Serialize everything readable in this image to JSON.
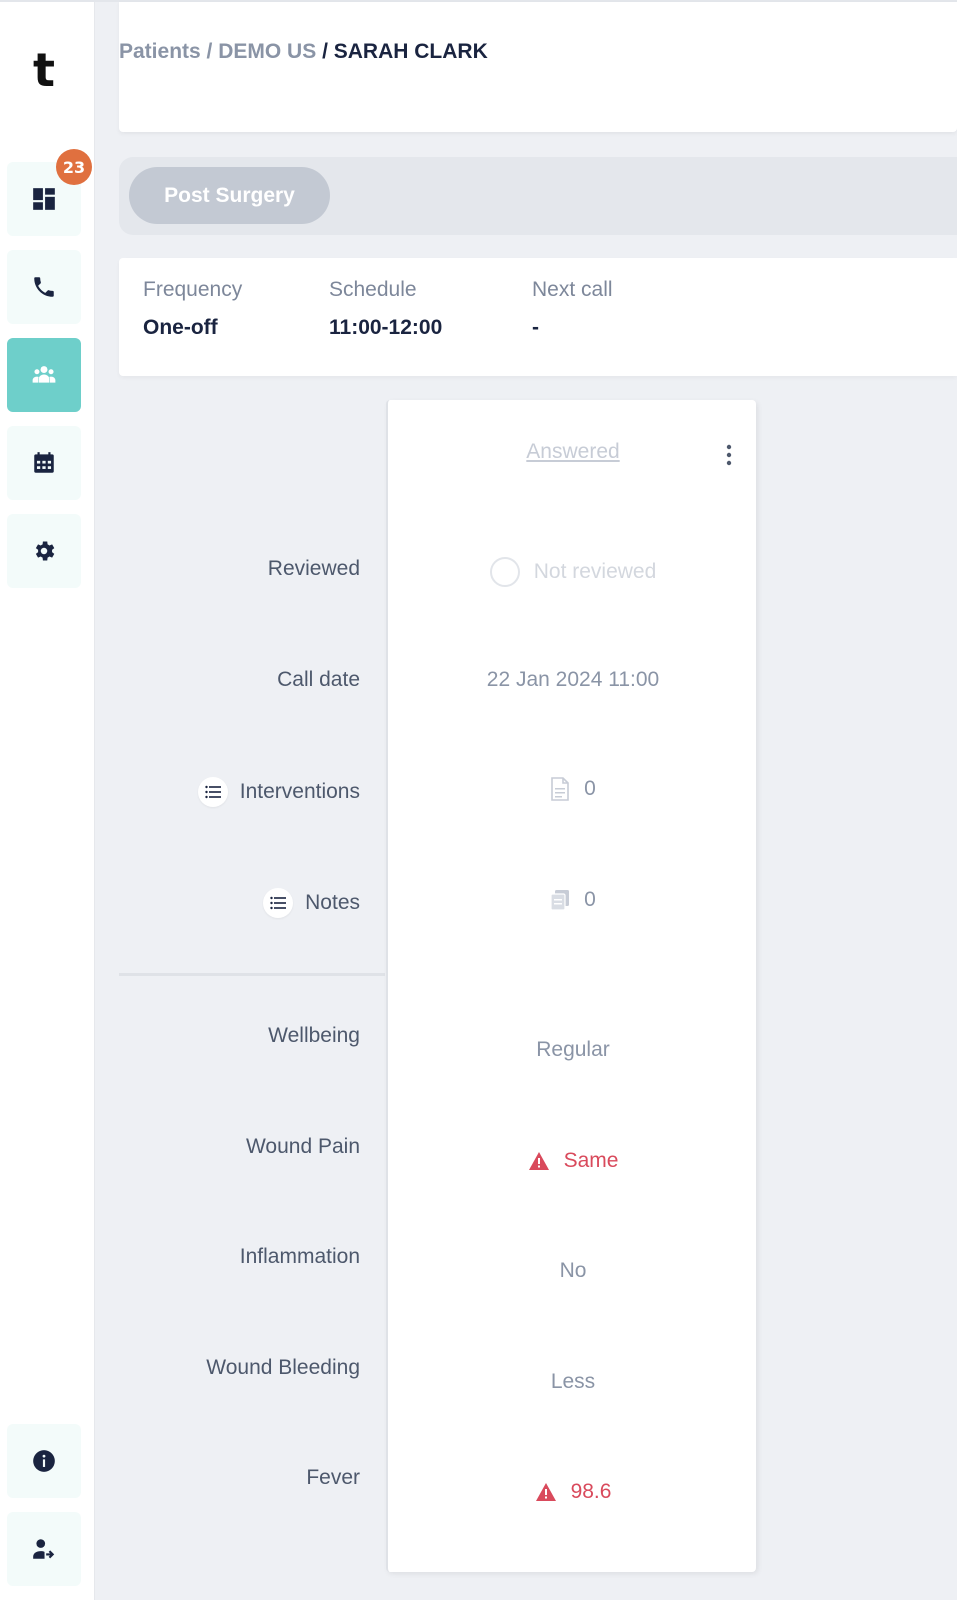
{
  "sidebar": {
    "logo": "t",
    "badge_count": "23",
    "nav": [
      {
        "name": "dashboard",
        "icon": "dashboard-icon"
      },
      {
        "name": "calls",
        "icon": "phone-icon"
      },
      {
        "name": "patients",
        "icon": "users-icon",
        "active": true
      },
      {
        "name": "calendar",
        "icon": "calendar-icon"
      },
      {
        "name": "settings",
        "icon": "gear-icon"
      }
    ],
    "bottom": [
      {
        "name": "info",
        "icon": "info-icon"
      },
      {
        "name": "logout",
        "icon": "user-logout-icon"
      }
    ]
  },
  "breadcrumb": {
    "patients": "Patients",
    "sep1": " / ",
    "org": "DEMO US",
    "sep2": " / ",
    "current": "SARAH CLARK"
  },
  "tabs": [
    {
      "label": "Post Surgery"
    }
  ],
  "info": {
    "frequency_label": "Frequency",
    "frequency_value": "One-off",
    "schedule_label": "Schedule",
    "schedule_value": "11:00-12:00",
    "next_call_label": "Next call",
    "next_call_value": "-"
  },
  "rows": {
    "reviewed": "Reviewed",
    "call_date": "Call date",
    "interventions": "Interventions",
    "notes": "Notes",
    "wellbeing": "Wellbeing",
    "wound_pain": "Wound Pain",
    "inflammation": "Inflammation",
    "wound_bleeding": "Wound Bleeding",
    "fever": "Fever"
  },
  "call": {
    "status": "Answered",
    "reviewed": "Not reviewed",
    "call_date": "22 Jan 2024 11:00",
    "interventions_count": "0",
    "notes_count": "0",
    "wellbeing": "Regular",
    "wound_pain": "Same",
    "inflammation": "No",
    "wound_bleeding": "Less",
    "fever": "98.6"
  },
  "colors": {
    "accent": "#6ecfca",
    "badge": "#e0703f",
    "alert": "#d94a5c",
    "navy": "#1a2440"
  }
}
